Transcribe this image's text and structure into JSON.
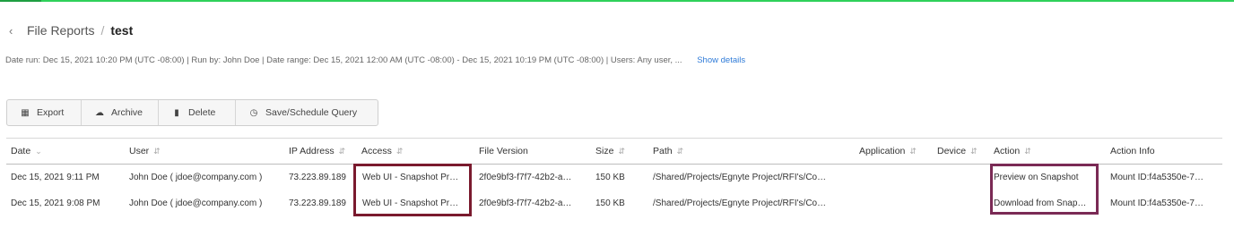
{
  "breadcrumb": {
    "back_icon": "chevron-left-icon",
    "parent": "File Reports",
    "separator": "/",
    "current": "test"
  },
  "meta": {
    "text": "Date run: Dec 15, 2021 10:20 PM (UTC -08:00) | Run by: John Doe | Date range: Dec 15, 2021 12:00 AM (UTC -08:00) - Dec 15, 2021 10:19 PM (UTC -08:00) | Users: Any user, ...",
    "show_details": "Show details"
  },
  "toolbar": {
    "export": "Export",
    "archive": "Archive",
    "delete": "Delete",
    "save_schedule": "Save/Schedule Query"
  },
  "table": {
    "headers": {
      "date": "Date",
      "user": "User",
      "ip": "IP Address",
      "access": "Access",
      "file_version": "File Version",
      "size": "Size",
      "path": "Path",
      "application": "Application",
      "device": "Device",
      "action": "Action",
      "action_info": "Action Info"
    },
    "rows": [
      {
        "date": "Dec 15, 2021 9:11 PM",
        "user": "John Doe ( jdoe@company.com )",
        "ip": "73.223.89.189",
        "access": "Web UI - Snapshot Pr…",
        "file_version": "2f0e9bf3-f7f7-42b2-a…",
        "size": "150 KB",
        "path": "/Shared/Projects/Egnyte Project/RFI's/Co…",
        "application": "",
        "device": "",
        "action": "Preview on Snapshot",
        "action_info": "Mount ID:f4a5350e-7…"
      },
      {
        "date": "Dec 15, 2021 9:08 PM",
        "user": "John Doe ( jdoe@company.com )",
        "ip": "73.223.89.189",
        "access": "Web UI - Snapshot Pr…",
        "file_version": "2f0e9bf3-f7f7-42b2-a…",
        "size": "150 KB",
        "path": "/Shared/Projects/Egnyte Project/RFI's/Co…",
        "application": "",
        "device": "",
        "action": "Download from Snap…",
        "action_info": "Mount ID:f4a5350e-7…"
      }
    ]
  },
  "colors": {
    "accent_line": "#2fd15a",
    "link": "#2f7bd8",
    "highlight_access": "#7a1a2e",
    "highlight_action": "#7a2a55"
  }
}
